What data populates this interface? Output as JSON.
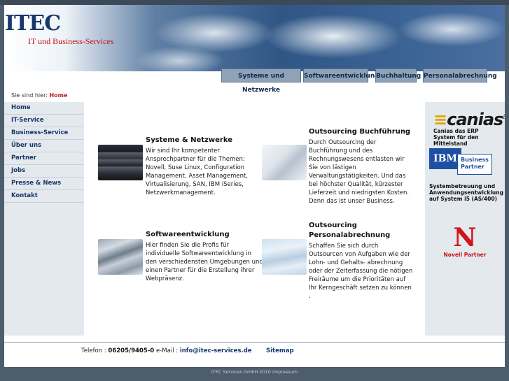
{
  "header": {
    "logo_text": "ITEC",
    "tagline": "IT und Business-Services"
  },
  "topnav": [
    {
      "label": "Systeme und Netzwerke"
    },
    {
      "label": "Softwareentwicklung"
    },
    {
      "label": "Buchhaltung"
    },
    {
      "label": "Personalabrechnung"
    }
  ],
  "breadcrumb": {
    "prefix": "Sie sind hier:",
    "current": "Home"
  },
  "sidebar": {
    "items": [
      {
        "label": "Home"
      },
      {
        "label": "IT-Service"
      },
      {
        "label": "Business-Service"
      },
      {
        "label": "Über uns"
      },
      {
        "label": "Partner"
      },
      {
        "label": "Jobs"
      },
      {
        "label": "Presse & News"
      },
      {
        "label": "Kontakt"
      }
    ]
  },
  "main": {
    "blocks": [
      {
        "title": "Systeme & Netzwerke",
        "text": "Wir sind Ihr kompetenter Ansprechpartner für die Themen: Novell, Suse Linux, Configuration Management, Asset Management, Virtualisierung, SAN, IBM iSeries, Netzwerkmanagement."
      },
      {
        "title": "Outsourcing Buchführung",
        "text": "Durch Outsourcing der Buchführung und des Rechnungswesens entlasten wir Sie von lästigen Verwaltungstätigkeiten. Und das bei höchster Qualität, kürzester Lieferzeit und niedrigsten Kosten. Denn das ist unser Business."
      },
      {
        "title": "Softwareentwicklung",
        "text": "Hier finden Sie die Profis für individuelle Softwareentwicklung in den verschiedensten Umgebungen und einen Partner für die Erstellung ihrer Webpräsenz."
      },
      {
        "title": "Outsourcing Personalabrechnung",
        "text": "Schaffen Sie sich durch Outsourcen von Aufgaben wie der Lohn- und Gehalts- abrechnung oder der Zeiterfassung die nötigen Freiräume um die Prioritäten auf Ihr Kerngeschäft setzen zu können ."
      }
    ]
  },
  "partners": {
    "canias": {
      "logo": "canias",
      "sup": "ERP",
      "text": "Canias das ERP System für den Mittelstand"
    },
    "ibm": {
      "logo": "IBM",
      "badge": "Business Partner",
      "text": "Systembetreuung und Anwendungsentwicklung auf System i5 (AS/400)"
    },
    "novell": {
      "logo": "N",
      "text": "Novell Partner"
    }
  },
  "footer": {
    "phone_label": "Telefon :",
    "phone": "06205/9405-0",
    "email_label": "e-Mail :",
    "email": "info@itec-services.de",
    "sitemap": "Sitemap"
  },
  "bottom": {
    "copyright": "ITEC Services GmbH 2010",
    "impressum": "Impressum"
  },
  "colors": {
    "brand_blue": "#17386a",
    "brand_red": "#d0141a",
    "nav_tab": "#8fa2b8",
    "sidebar_bg": "#e4e9ee"
  }
}
